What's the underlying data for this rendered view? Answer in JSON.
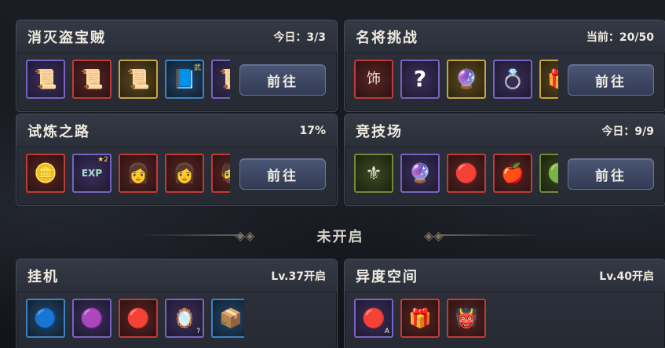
{
  "panels": [
    {
      "title": "消灭盗宝贼",
      "status": "今日：3/3",
      "button": "前往",
      "items": [
        {
          "icon": "scroll-icon",
          "glyph": "📜",
          "rarity": "purple"
        },
        {
          "icon": "scroll-icon",
          "glyph": "📜",
          "rarity": "red"
        },
        {
          "icon": "scroll-icon",
          "glyph": "📜",
          "rarity": "gold"
        },
        {
          "icon": "scroll-icon",
          "glyph": "📘",
          "rarity": "blue",
          "badge": "武"
        },
        {
          "icon": "scroll-icon",
          "glyph": "📜",
          "rarity": "purple"
        }
      ]
    },
    {
      "title": "名将挑战",
      "status": "当前：20/50",
      "button": "前往",
      "items": [
        {
          "icon": "ornament-icon",
          "glyph": "饰",
          "rarity": "red"
        },
        {
          "icon": "mystery-icon",
          "glyph": "?",
          "rarity": "purple"
        },
        {
          "icon": "pendant-icon",
          "glyph": "🔮",
          "rarity": "gold"
        },
        {
          "icon": "ring-icon",
          "glyph": "💍",
          "rarity": "purple"
        },
        {
          "icon": "chest-icon",
          "glyph": "🎁",
          "rarity": "gold"
        }
      ]
    },
    {
      "title": "试炼之路",
      "status": "17%",
      "button": "前往",
      "items": [
        {
          "icon": "coin-icon",
          "glyph": "🪙",
          "rarity": "red"
        },
        {
          "icon": "exp-icon",
          "glyph": "EXP",
          "rarity": "purple",
          "badge": "★2"
        },
        {
          "icon": "hero-portrait-icon",
          "glyph": "👩",
          "rarity": "red"
        },
        {
          "icon": "hero-portrait-icon",
          "glyph": "👩",
          "rarity": "red"
        },
        {
          "icon": "hero-portrait-icon",
          "glyph": "🧔",
          "rarity": "red"
        }
      ]
    },
    {
      "title": "竞技场",
      "status": "今日：9/9",
      "button": "前往",
      "items": [
        {
          "icon": "token-icon",
          "glyph": "⚜",
          "rarity": "green"
        },
        {
          "icon": "orb-icon",
          "glyph": "🔮",
          "rarity": "purple"
        },
        {
          "icon": "orb-icon",
          "glyph": "🔴",
          "rarity": "red"
        },
        {
          "icon": "fruit-icon",
          "glyph": "🍎",
          "rarity": "red"
        },
        {
          "icon": "orb-icon",
          "glyph": "🟢",
          "rarity": "green"
        }
      ]
    },
    {
      "title": "挂机",
      "status": "Lv.37开启",
      "button": "",
      "items": [
        {
          "icon": "orb-icon",
          "glyph": "🔵",
          "rarity": "blue"
        },
        {
          "icon": "orb-icon",
          "glyph": "🟣",
          "rarity": "purple"
        },
        {
          "icon": "orb-icon",
          "glyph": "🔴",
          "rarity": "red"
        },
        {
          "icon": "mirror-icon",
          "glyph": "🪞",
          "rarity": "purple",
          "sub": "?"
        },
        {
          "icon": "box-icon",
          "glyph": "📦",
          "rarity": "blue"
        }
      ]
    },
    {
      "title": "异度空间",
      "status": "Lv.40开启",
      "button": "",
      "items": [
        {
          "icon": "orb-icon",
          "glyph": "🔴",
          "rarity": "purple",
          "sub": "A"
        },
        {
          "icon": "chest-icon",
          "glyph": "🎁",
          "rarity": "red"
        },
        {
          "icon": "hero-portrait-icon",
          "glyph": "👹",
          "rarity": "red"
        }
      ]
    }
  ],
  "divider": {
    "label": "未开启"
  }
}
